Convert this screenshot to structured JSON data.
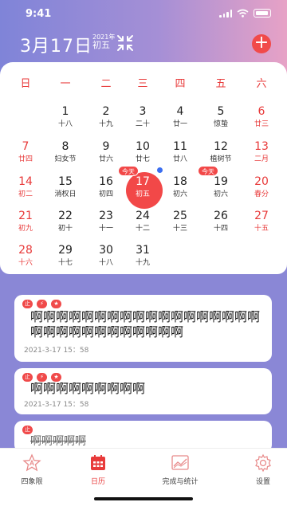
{
  "status": {
    "time": "9:41"
  },
  "header": {
    "date_title": "3月17日",
    "lunar_year": "2021年",
    "lunar_day": "初五"
  },
  "weekdays": [
    "日",
    "一",
    "二",
    "三",
    "四",
    "五",
    "六"
  ],
  "calendar": {
    "rows": [
      [
        null,
        null,
        {
          "n": "1",
          "s": "十八"
        },
        {
          "n": "2",
          "s": "十九"
        },
        {
          "n": "3",
          "s": "二十"
        },
        {
          "n": "4",
          "s": "廿一"
        },
        {
          "n": "5",
          "s": "惊蛰"
        },
        {
          "n": "6",
          "s": "廿三"
        }
      ],
      [
        {
          "n": "7",
          "s": "廿四"
        },
        {
          "n": "8",
          "s": "妇女节"
        },
        {
          "n": "9",
          "s": "廿六"
        },
        {
          "n": "10",
          "s": "廿七"
        },
        {
          "n": "11",
          "s": "廿八"
        },
        {
          "n": "12",
          "s": "植树节"
        },
        {
          "n": "13",
          "s": "二月"
        }
      ],
      [
        {
          "n": "14",
          "s": "初二"
        },
        {
          "n": "15",
          "s": "消权日"
        },
        {
          "n": "16",
          "s": "初四"
        },
        {
          "n": "17",
          "s": "初五"
        },
        {
          "n": "18",
          "s": "初六"
        },
        {
          "n": "19",
          "s": "初六"
        },
        {
          "n": "20",
          "s": "春分"
        }
      ],
      [
        {
          "n": "21",
          "s": "初九"
        },
        {
          "n": "22",
          "s": "初十"
        },
        {
          "n": "23",
          "s": "十一"
        },
        {
          "n": "24",
          "s": "十二"
        },
        {
          "n": "25",
          "s": "十三"
        },
        {
          "n": "26",
          "s": "十四"
        },
        {
          "n": "27",
          "s": "十五"
        }
      ],
      [
        {
          "n": "28",
          "s": "十六"
        },
        {
          "n": "29",
          "s": "十七"
        },
        {
          "n": "30",
          "s": "十八"
        },
        {
          "n": "31",
          "s": "十九"
        }
      ]
    ],
    "today_tag": "今天"
  },
  "notes": [
    {
      "badges": [
        "止",
        "⚡",
        "★"
      ],
      "text": "啊啊啊啊啊啊啊啊啊啊啊啊啊啊啊啊啊啊啊啊啊啊啊啊啊啊啊啊啊啊",
      "time": "2021-3-17  15：58"
    },
    {
      "badges": [
        "止",
        "⚡",
        "★"
      ],
      "text": "啊啊啊啊啊啊啊啊啊",
      "time": "2021-3-17  15：58"
    },
    {
      "badges": [
        "止"
      ],
      "text": "啊啊啊啊啊"
    }
  ],
  "tabs": [
    {
      "label": "四象限",
      "icon": "star-icon"
    },
    {
      "label": "日历",
      "icon": "calendar-icon"
    },
    {
      "label": "完成与统计",
      "icon": "chart-icon"
    },
    {
      "label": "设置",
      "icon": "gear-icon"
    }
  ],
  "colors": {
    "accent": "#f24848",
    "primary": "#7f84d8"
  }
}
